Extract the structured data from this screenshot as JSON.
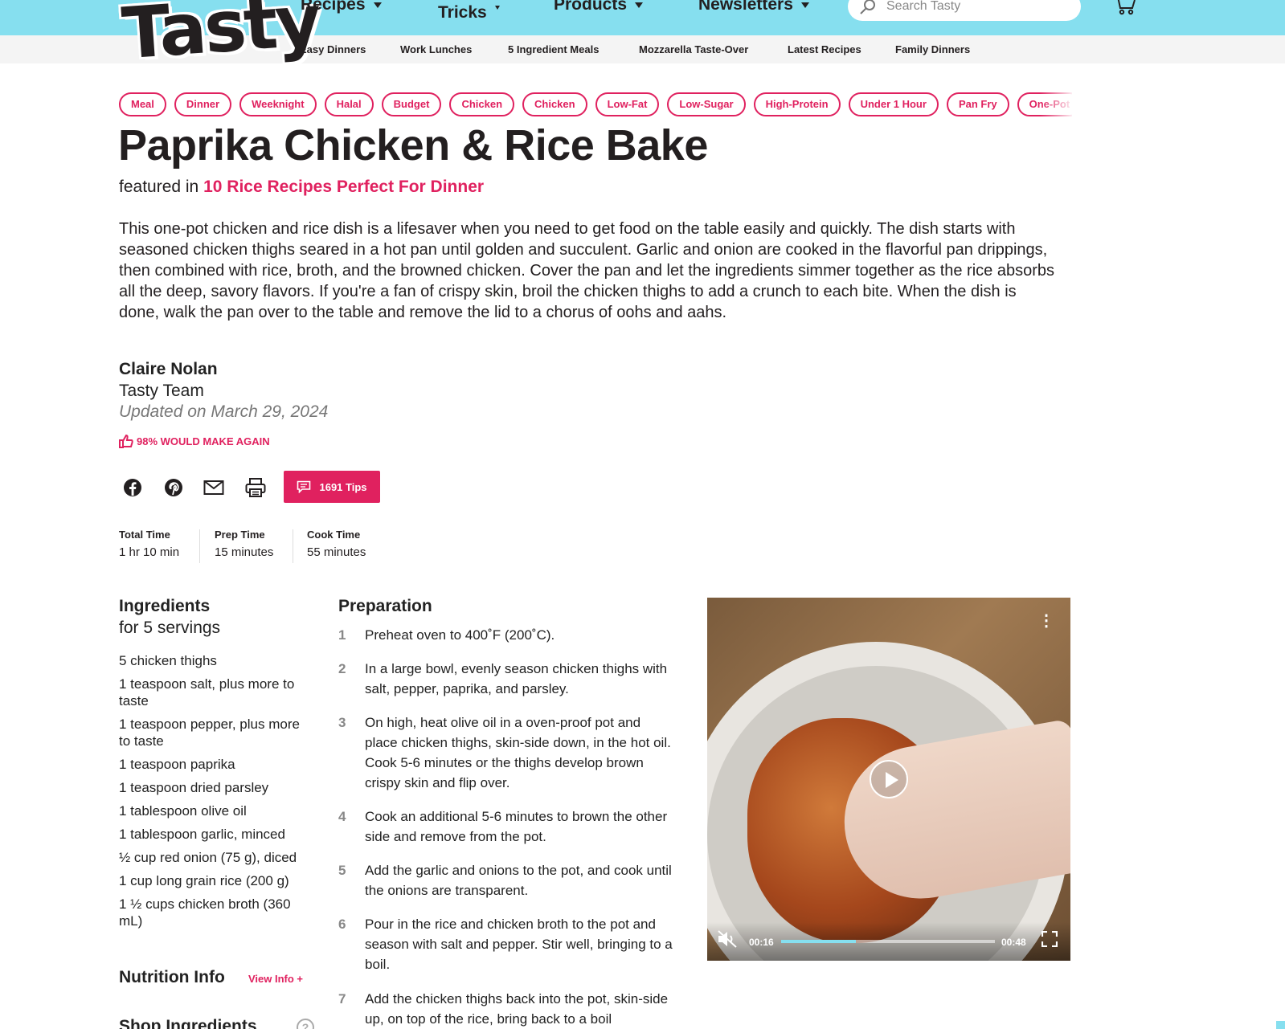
{
  "brand": {
    "logo_text": "Tasty"
  },
  "nav": {
    "items": [
      {
        "label": "Recipes"
      },
      {
        "label": "Tricks"
      },
      {
        "label": "Products"
      },
      {
        "label": "Newsletters"
      }
    ],
    "search_placeholder": "Search Tasty"
  },
  "subnav": [
    "Easy Dinners",
    "Work Lunches",
    "5 Ingredient Meals",
    "Mozzarella Taste-Over",
    "Latest Recipes",
    "Family Dinners"
  ],
  "tags": [
    "Meal",
    "Dinner",
    "Weeknight",
    "Halal",
    "Budget",
    "Chicken",
    "Chicken",
    "Low-Fat",
    "Low-Sugar",
    "High-Protein",
    "Under 1 Hour",
    "Pan Fry",
    "One-Pot"
  ],
  "recipe": {
    "title": "Paprika Chicken & Rice Bake",
    "featured_prefix": "featured in",
    "featured_link": "10 Rice Recipes Perfect For Dinner",
    "description": "This one-pot chicken and rice dish is a lifesaver when you need to get food on the table easily and quickly. The dish starts with seasoned chicken thighs seared in a hot pan until golden and succulent. Garlic and onion are cooked in the flavorful pan drippings, then combined with rice, broth, and the browned chicken. Cover the pan and let the ingredients simmer together as the rice absorbs all the deep, savory flavors. If you're a fan of crispy skin, broil the chicken thighs to add a crunch to each bite. When the dish is done, walk the pan over to the table and remove the lid to a chorus of oohs and aahs.",
    "author": "Claire Nolan",
    "team": "Tasty Team",
    "updated": "Updated on March 29, 2024",
    "rating": "98% WOULD MAKE AGAIN",
    "tips_label": "1691 Tips",
    "times": [
      {
        "label": "Total Time",
        "value": "1 hr 10 min"
      },
      {
        "label": "Prep Time",
        "value": "15 minutes"
      },
      {
        "label": "Cook Time",
        "value": "55 minutes"
      }
    ]
  },
  "ingredients": {
    "title": "Ingredients",
    "servings": "for 5 servings",
    "items": [
      "5 chicken thighs",
      "1 teaspoon salt, plus more to taste",
      "1 teaspoon pepper, plus more to taste",
      "1 teaspoon paprika",
      "1 teaspoon dried parsley",
      "1 tablespoon olive oil",
      "1 tablespoon garlic, minced",
      "½ cup red onion (75 g), diced",
      "1 cup long grain rice (200 g)",
      "1 ½ cups chicken broth  (360 mL)"
    ],
    "nutrition_title": "Nutrition Info",
    "view_info": "View Info +",
    "shop_title": "Shop Ingredients",
    "help_glyph": "?"
  },
  "preparation": {
    "title": "Preparation",
    "steps": [
      {
        "num": "1",
        "text": "Preheat oven to 400˚F (200˚C)."
      },
      {
        "num": "2",
        "text": "In a large bowl, evenly season chicken thighs with salt, pepper, paprika, and parsley."
      },
      {
        "num": "3",
        "text": "On high, heat olive oil in a oven-proof pot and place chicken thighs, skin-side down, in the hot oil. Cook 5-6 minutes or the thighs develop brown crispy skin and flip over."
      },
      {
        "num": "4",
        "text": "Cook an additional 5-6 minutes to brown the other side and remove from the pot."
      },
      {
        "num": "5",
        "text": "Add the garlic and onions to the pot, and cook until the onions are transparent."
      },
      {
        "num": "6",
        "text": "Pour in the rice and chicken broth to the pot and season with salt and pepper. Stir well, bringing to a boil."
      },
      {
        "num": "7",
        "text": "Add the chicken thighs back into the pot, skin-side up, on top of the rice, bring back to a boil"
      }
    ]
  },
  "video": {
    "current_time": "00:16",
    "duration": "00:48",
    "progress_fraction": 0.35,
    "buffered_fraction": 0.91
  },
  "colors": {
    "accent": "#e0215f",
    "header": "#86dfef"
  }
}
